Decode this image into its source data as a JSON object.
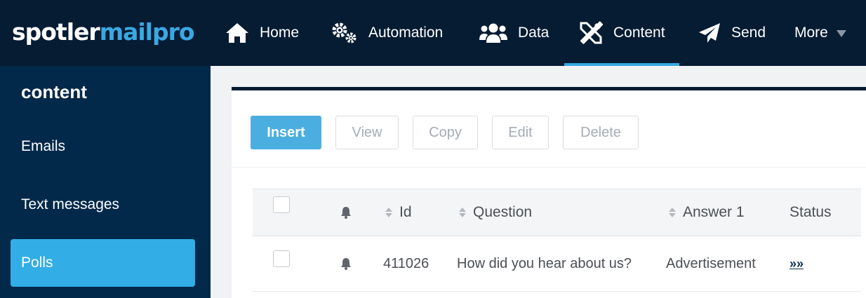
{
  "brand": {
    "part1": "spotler",
    "part2": "mailpro"
  },
  "nav": {
    "items": [
      {
        "label": "Home",
        "icon": "home-icon"
      },
      {
        "label": "Automation",
        "icon": "gears-icon"
      },
      {
        "label": "Data",
        "icon": "users-icon"
      },
      {
        "label": "Content",
        "icon": "design-tools-icon",
        "active": true
      },
      {
        "label": "Send",
        "icon": "paper-plane-icon"
      },
      {
        "label": "More",
        "icon": "caret-down-icon"
      }
    ]
  },
  "sidebar": {
    "title": "content",
    "items": [
      {
        "label": "Emails"
      },
      {
        "label": "Text messages"
      },
      {
        "label": "Polls",
        "active": true
      }
    ]
  },
  "toolbar": {
    "insert": "Insert",
    "view": "View",
    "copy": "Copy",
    "edit": "Edit",
    "delete": "Delete"
  },
  "table": {
    "headers": {
      "id": "Id",
      "question": "Question",
      "answer1": "Answer 1",
      "status": "Status"
    },
    "rows": [
      {
        "id": "411026",
        "question": "How did you hear about us?",
        "answer1": "Advertisement",
        "status": "»»"
      }
    ]
  },
  "colors": {
    "topbar": "#051c33",
    "sidebar": "#03294a",
    "accent": "#32ade6"
  }
}
